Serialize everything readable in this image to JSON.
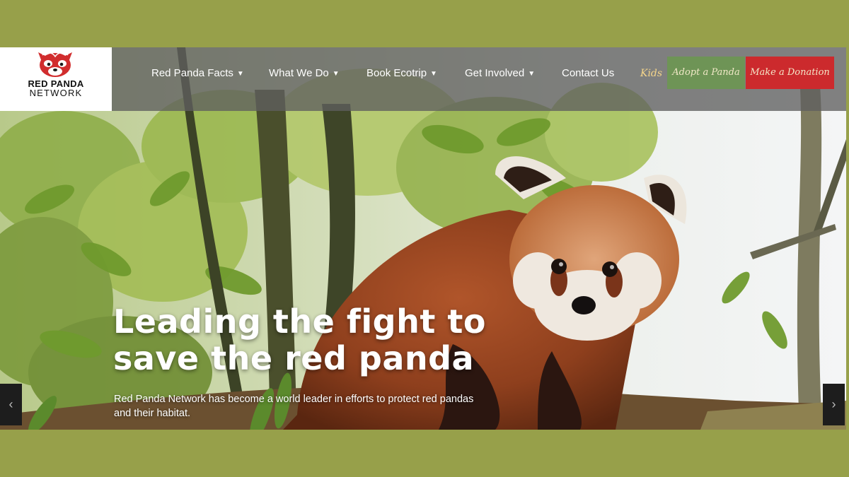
{
  "logo": {
    "line1": "RED PANDA",
    "line2": "NETWORK",
    "icon": "red-panda-face-icon"
  },
  "nav": {
    "items": [
      {
        "label": "Red Panda Facts",
        "dropdown": true
      },
      {
        "label": "What We Do",
        "dropdown": true
      },
      {
        "label": "Book Ecotrip",
        "dropdown": true
      },
      {
        "label": "Get Involved",
        "dropdown": true
      },
      {
        "label": "Contact Us",
        "dropdown": false
      }
    ],
    "kids_label": "Kids",
    "adopt_label": "Adopt a Panda",
    "donate_label": "Make a Donation",
    "caret_glyph": "▼"
  },
  "hero": {
    "title_line1": "Leading the fight to",
    "title_line2": "save the red panda",
    "subtitle": "Red Panda Network has become a world leader in efforts to protect red pandas and their habitat.",
    "prev_glyph": "‹",
    "next_glyph": "›"
  },
  "colors": {
    "page_background": "#97a04a",
    "adopt_button": "#6e9456",
    "donate_button": "#cc2a2d",
    "kids_text": "#f5d58a"
  }
}
